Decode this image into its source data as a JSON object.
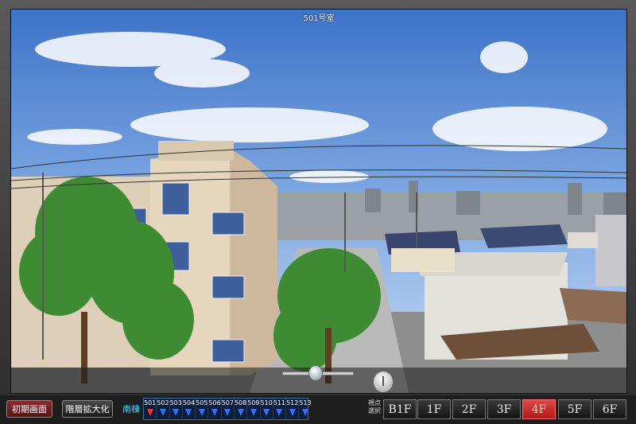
{
  "viewport": {
    "room_label": "501号室"
  },
  "controls": {
    "initial_screen": "初期画面",
    "floor_zoom": "階層拡大化",
    "building": "南棟",
    "viewpoint_label_1": "視点",
    "viewpoint_label_2": "選択"
  },
  "rooms": [
    "501",
    "502",
    "503",
    "504",
    "505",
    "506",
    "507",
    "508",
    "509",
    "510",
    "511",
    "512",
    "513"
  ],
  "selected_room": "501",
  "floors": [
    "B1F",
    "1F",
    "2F",
    "3F",
    "4F",
    "5F",
    "6F"
  ],
  "selected_floor": "4F",
  "colors": {
    "active_floor": "#d62828",
    "room_marker": "#2e73ff",
    "selected_marker": "#ff3030"
  }
}
